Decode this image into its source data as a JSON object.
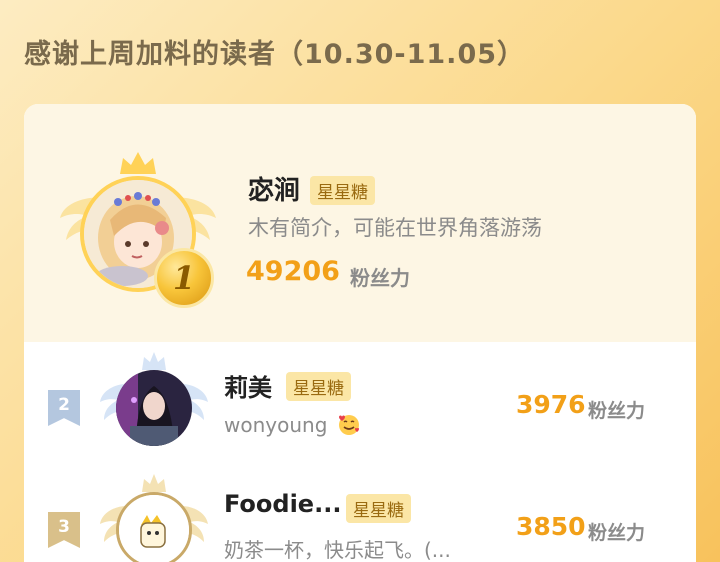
{
  "header": {
    "title": "感谢上周加料的读者（10.30-11.05）"
  },
  "top_reader": {
    "rank": "1",
    "name": "宓涧",
    "badge": "星星糖",
    "description": "木有简介，可能在世界角落游荡",
    "score": "49206",
    "score_unit": "粉丝力"
  },
  "readers": [
    {
      "rank": "2",
      "name": "莉美",
      "badge": "星星糖",
      "description": "wonyoung",
      "score": "3976",
      "score_unit": "粉丝力"
    },
    {
      "rank": "3",
      "name": "Foodie...",
      "badge": "星星糖",
      "description": "奶茶一杯，快乐起飞。(...",
      "score": "3850",
      "score_unit": "粉丝力"
    }
  ],
  "colors": {
    "accent": "#f2a018",
    "badge_bg": "#fbe6a6",
    "badge_text": "#9a6a10",
    "gold": "#ffd257",
    "silver": "#b4c7df",
    "bronze": "#d9c08a"
  },
  "icons": [
    "crown-icon",
    "wing-icon",
    "rank-1-medal-icon",
    "rank-2-flag-icon",
    "rank-3-flag-icon",
    "smiling-hearts-emoji-icon"
  ]
}
